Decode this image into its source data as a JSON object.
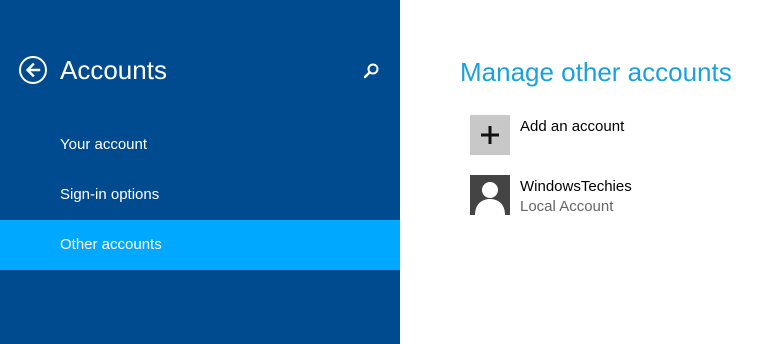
{
  "sidebar": {
    "title": "Accounts",
    "back_icon": "back-arrow-icon",
    "search_icon": "search-icon",
    "items": [
      {
        "label": "Your account",
        "selected": false
      },
      {
        "label": "Sign-in options",
        "selected": false
      },
      {
        "label": "Other accounts",
        "selected": true
      }
    ]
  },
  "main": {
    "title": "Manage other accounts",
    "add_account": {
      "label": "Add an account",
      "icon": "plus-icon"
    },
    "accounts": [
      {
        "name": "WindowsTechies",
        "type": "Local Account",
        "icon": "user-avatar-icon"
      }
    ]
  },
  "colors": {
    "sidebar_bg": "#004a8f",
    "selected_bg": "#00a8ff",
    "title_accent": "#1ba1e2",
    "tile_gray": "#c8c8c8",
    "avatar_bg": "#444444"
  }
}
